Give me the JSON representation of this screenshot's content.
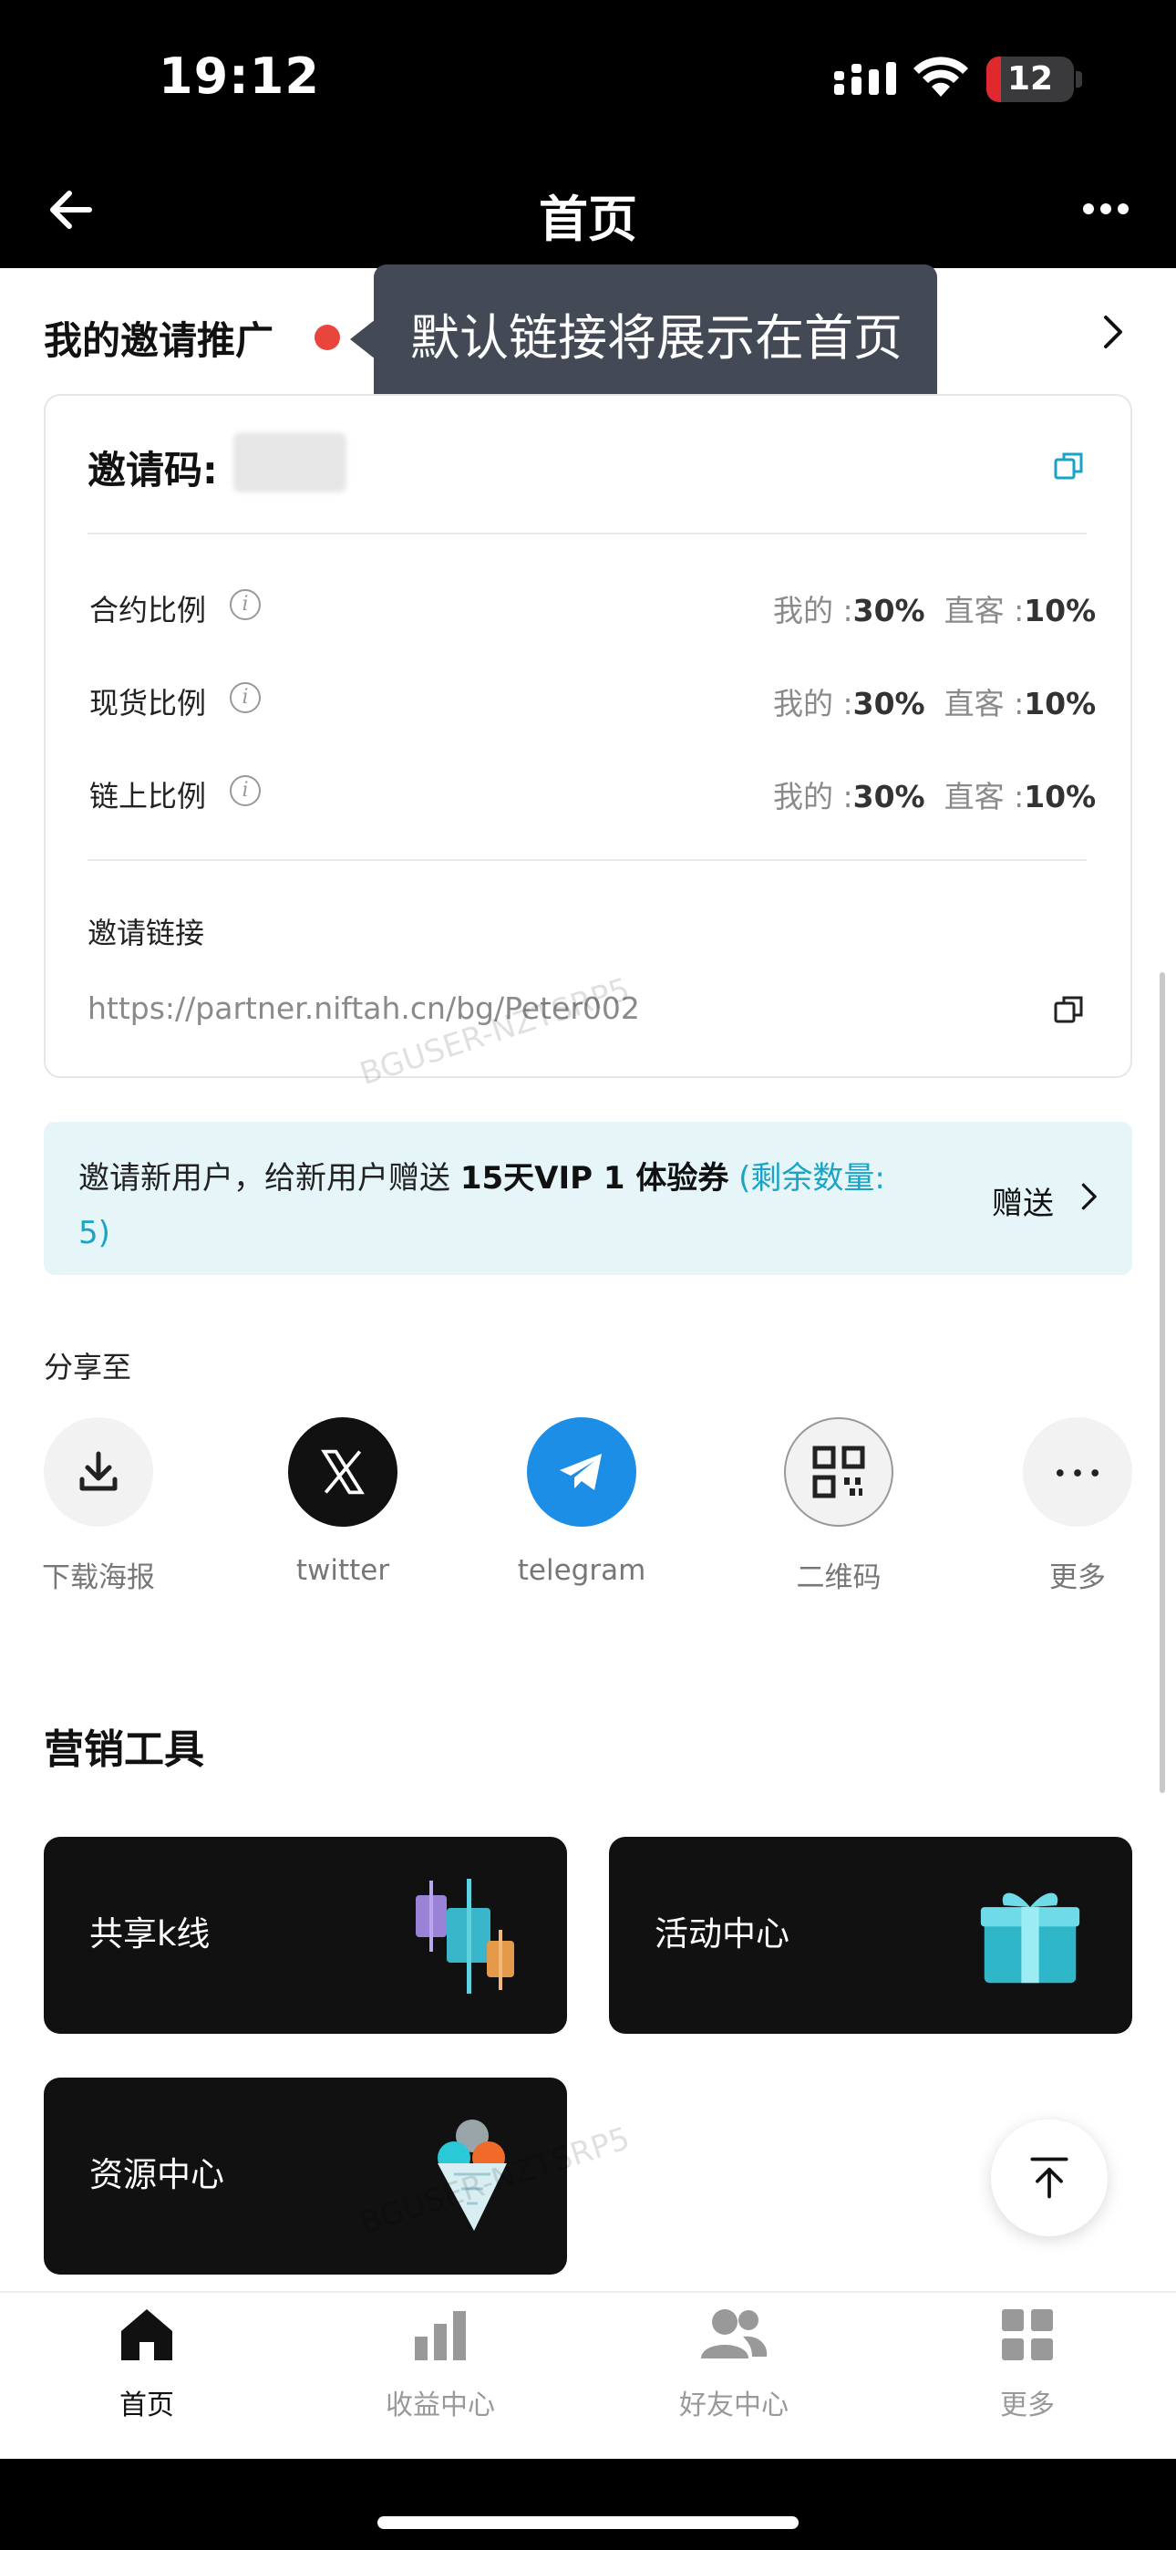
{
  "status_bar": {
    "time": "19:12",
    "battery": "12"
  },
  "nav": {
    "title": "首页"
  },
  "tooltip": {
    "text": "默认链接将展示在首页"
  },
  "invite_section": {
    "title": "我的邀请推广"
  },
  "card": {
    "code_label": "邀请码:",
    "rows": [
      {
        "label": "合约比例",
        "mine_label": "我的 :",
        "mine": "30%",
        "direct_label": "直客 :",
        "direct": "10%"
      },
      {
        "label": "现货比例",
        "mine_label": "我的 :",
        "mine": "30%",
        "direct_label": "直客 :",
        "direct": "10%"
      },
      {
        "label": "链上比例",
        "mine_label": "我的 :",
        "mine": "30%",
        "direct_label": "直客 :",
        "direct": "10%"
      }
    ],
    "link_label": "邀请链接",
    "link_value": "https://partner.niftah.cn/bg/Peter002"
  },
  "watermark": "BGUSER-NZTSRP5",
  "banner": {
    "text_a": "邀请新用户，给新用户赠送",
    "text_b": "15天VIP 1 体验券",
    "text_c": "(剩余数量:",
    "text_d": "5)",
    "action": "赠送"
  },
  "share": {
    "title": "分享至",
    "items": [
      {
        "label": "下载海报",
        "icon": "download-icon"
      },
      {
        "label": "twitter",
        "icon": "x-logo-icon"
      },
      {
        "label": "telegram",
        "icon": "telegram-icon"
      },
      {
        "label": "二维码",
        "icon": "qr-code-icon"
      },
      {
        "label": "更多",
        "icon": "more-icon"
      }
    ]
  },
  "tools": {
    "title": "营销工具",
    "items": [
      {
        "label": "共享k线",
        "icon": "kline-3d-icon"
      },
      {
        "label": "活动中心",
        "icon": "gift-box-icon"
      },
      {
        "label": "资源中心",
        "icon": "ice-cream-icon"
      }
    ]
  },
  "tabbar": [
    {
      "label": "首页",
      "icon": "home-icon",
      "active": true
    },
    {
      "label": "收益中心",
      "icon": "bar-chart-icon"
    },
    {
      "label": "好友中心",
      "icon": "friends-icon"
    },
    {
      "label": "更多",
      "icon": "grid-icon"
    }
  ],
  "colors": {
    "accent": "#1aa3c6",
    "dark": "#111111",
    "banner_bg": "#e6f6f8",
    "telegram": "#1d8ee6",
    "red_dot": "#e8453c"
  }
}
